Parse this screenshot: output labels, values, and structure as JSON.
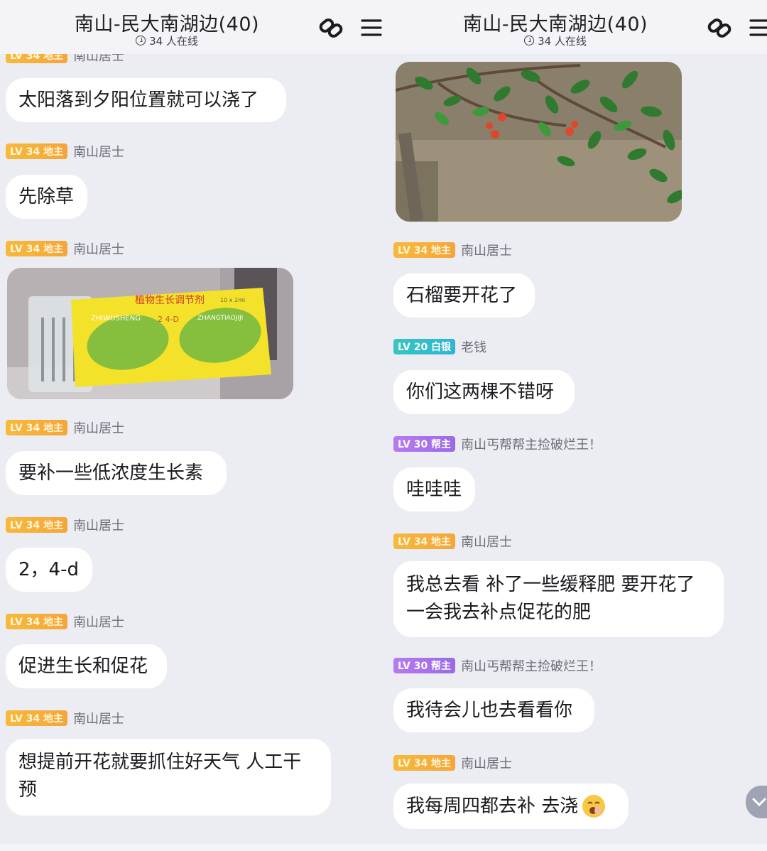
{
  "header": {
    "title": "南山-民大南湖边(40)",
    "online": "34 人在线"
  },
  "colors": {
    "bg": "#ecedf3",
    "gold_badge": "#f5ac3a",
    "teal_badge": "#34bdcb",
    "purple_badge": "#a572ec"
  },
  "left_panel": {
    "partial_badge": "LV 34 地主",
    "partial_sender": "南山居士",
    "messages": [
      {
        "text": "太阳落到夕阳位置就可以浇了"
      },
      {
        "badge": "LV 34 地主",
        "sender": "南山居士",
        "text": "先除草"
      },
      {
        "badge": "LV 34 地主",
        "sender": "南山居士",
        "image": "photo-of-plant-growth-regulator-packet",
        "packet": {
          "title": "植物生长调节剂",
          "spec": "10 x 2ml",
          "left_text": "ZHIWUSHENG",
          "mid_text": "2 4-D",
          "right_text": "ZHANGTIAOJIJI"
        }
      },
      {
        "badge": "LV 34 地主",
        "sender": "南山居士",
        "text": "要补一些低浓度生长素"
      },
      {
        "badge": "LV 34 地主",
        "sender": "南山居士",
        "text": "2，4-d"
      },
      {
        "badge": "LV 34 地主",
        "sender": "南山居士",
        "text": "促进生长和促花"
      },
      {
        "badge": "LV 34 地主",
        "sender": "南山居士",
        "text_lines": [
          "想提前开花就要抓住好天气 人工干",
          "预"
        ]
      }
    ]
  },
  "right_panel": {
    "messages": [
      {
        "image": "photo-of-pomegranate-tree-branch"
      },
      {
        "badge": "LV 34 地主",
        "sender": "南山居士",
        "text": "石榴要开花了"
      },
      {
        "badge": "LV 20 白银",
        "sender": "老钱",
        "text": "你们这两棵不错呀"
      },
      {
        "badge": "LV 30 帮主",
        "sender": "南山丐帮帮主捡破烂王！",
        "text": "哇哇哇"
      },
      {
        "badge": "LV 34 地主",
        "sender": "南山居士",
        "text_lines": [
          "我总去看 补了一些缓释肥 要开花了",
          "一会我去补点促花的肥"
        ]
      },
      {
        "badge": "LV 30 帮主",
        "sender": "南山丐帮帮主捡破烂王！",
        "text": "我待会儿也去看看你"
      },
      {
        "badge": "LV 34 地主",
        "sender": "南山居士",
        "text": "我每周四都去补 去浇",
        "emoji": "yawning-face-emoji"
      }
    ]
  }
}
